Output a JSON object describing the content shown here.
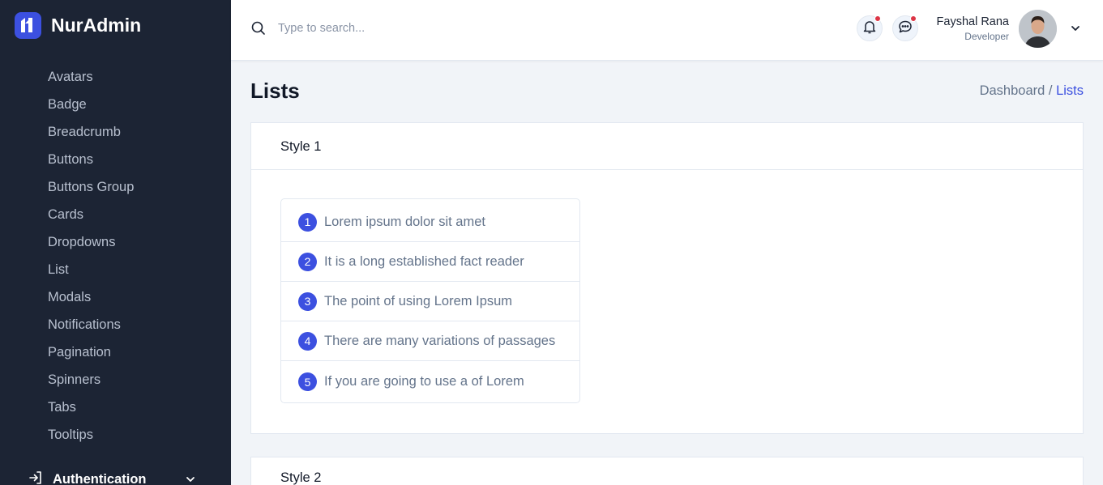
{
  "brand": {
    "name": "NurAdmin",
    "logo_icon": "nuradmin-logo-icon"
  },
  "sidebar": {
    "items": [
      {
        "label": "Avatars"
      },
      {
        "label": "Badge"
      },
      {
        "label": "Breadcrumb"
      },
      {
        "label": "Buttons"
      },
      {
        "label": "Buttons Group"
      },
      {
        "label": "Cards"
      },
      {
        "label": "Dropdowns"
      },
      {
        "label": "List"
      },
      {
        "label": "Modals"
      },
      {
        "label": "Notifications"
      },
      {
        "label": "Pagination"
      },
      {
        "label": "Spinners"
      },
      {
        "label": "Tabs"
      },
      {
        "label": "Tooltips"
      }
    ],
    "section": {
      "label": "Authentication",
      "icon": "login-icon"
    }
  },
  "header": {
    "search": {
      "placeholder": "Type to search..."
    },
    "user": {
      "name": "Fayshal Rana",
      "role": "Developer"
    }
  },
  "page": {
    "title": "Lists",
    "breadcrumb": {
      "parent": "Dashboard /",
      "current": "Lists"
    }
  },
  "cards": [
    {
      "title": "Style 1",
      "items": [
        {
          "num": "1",
          "text": "Lorem ipsum dolor sit amet"
        },
        {
          "num": "2",
          "text": "It is a long established fact reader"
        },
        {
          "num": "3",
          "text": "The point of using Lorem Ipsum"
        },
        {
          "num": "4",
          "text": "There are many variations of passages"
        },
        {
          "num": "5",
          "text": "If you are going to use a of Lorem"
        }
      ]
    },
    {
      "title": "Style 2"
    }
  ],
  "colors": {
    "sidebar_bg": "#1c2434",
    "accent": "#3c50e0",
    "badge_dot": "#dc3545",
    "page_bg": "#f1f4f8"
  }
}
